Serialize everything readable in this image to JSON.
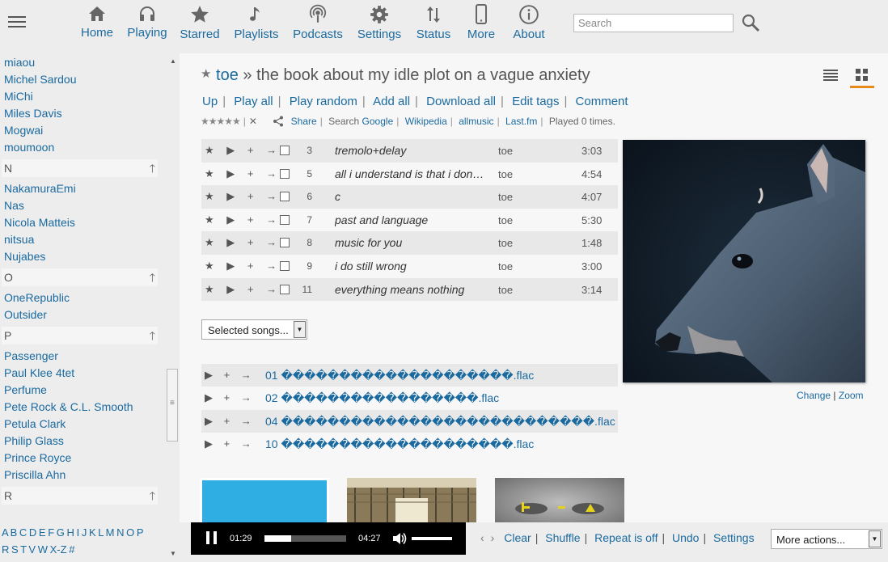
{
  "nav": {
    "home": "Home",
    "playing": "Playing",
    "starred": "Starred",
    "playlists": "Playlists",
    "podcasts": "Podcasts",
    "settings": "Settings",
    "status": "Status",
    "more": "More",
    "about": "About"
  },
  "search": {
    "placeholder": "Search"
  },
  "sidebar": {
    "group_m_tail": [
      "miaou",
      "Michel Sardou",
      "MiChi",
      "Miles Davis",
      "Mogwai",
      "moumoon"
    ],
    "group_n": {
      "letter": "N",
      "artists": [
        "NakamuraEmi",
        "Nas",
        "Nicola Matteis",
        "nitsua",
        "Nujabes"
      ]
    },
    "group_o": {
      "letter": "O",
      "artists": [
        "OneRepublic",
        "Outsider"
      ]
    },
    "group_p": {
      "letter": "P",
      "artists": [
        "Passenger",
        "Paul Klee 4tet",
        "Perfume",
        "Pete Rock & C.L. Smooth",
        "Petula Clark",
        "Philip Glass",
        "Prince Royce",
        "Priscilla Ahn"
      ]
    },
    "next_letter": "R",
    "up_arrow": "🡑",
    "alphabet_line1": "A B C D E F G H I J K L M N O P",
    "alphabet_line2": "R S T V W X-Z #"
  },
  "album": {
    "star": "★",
    "artist": "toe",
    "separator": "»",
    "title": "the book about my idle plot on a vague anxiety"
  },
  "actions": {
    "up": "Up",
    "play_all": "Play all",
    "play_random": "Play random",
    "add_all": "Add all",
    "download_all": "Download all",
    "edit_tags": "Edit tags",
    "comment": "Comment"
  },
  "meta": {
    "rating": "★★★★★",
    "clear": "✕",
    "share": "Share",
    "search_prefix": "Search",
    "google": "Google",
    "wikipedia": "Wikipedia",
    "allmusic": "allmusic",
    "lastfm": "Last.fm",
    "played": "Played 0 times."
  },
  "tracks": [
    {
      "num": "3",
      "title": "tremolo+delay",
      "artist": "toe",
      "length": "3:03"
    },
    {
      "num": "5",
      "title": "all i understand is that i don't understand",
      "artist": "toe",
      "length": "4:54"
    },
    {
      "num": "6",
      "title": "c",
      "artist": "toe",
      "length": "4:07"
    },
    {
      "num": "7",
      "title": "past and language",
      "artist": "toe",
      "length": "5:30"
    },
    {
      "num": "8",
      "title": "music for you",
      "artist": "toe",
      "length": "1:48"
    },
    {
      "num": "9",
      "title": "i do still wrong",
      "artist": "toe",
      "length": "3:00"
    },
    {
      "num": "11",
      "title": "everything means nothing",
      "artist": "toe",
      "length": "3:14"
    }
  ],
  "track_controls": "★ ▶ + →",
  "selected_songs": "Selected songs...",
  "files": [
    {
      "name": "01 ��������������������.flac"
    },
    {
      "name": "02 �����������������.flac"
    },
    {
      "name": "04 ���������������������������.flac"
    },
    {
      "name": "10 ��������������������.flac"
    }
  ],
  "file_controls": "▶ + →",
  "cover": {
    "change": "Change",
    "zoom": "Zoom",
    "sep": "|"
  },
  "player": {
    "current_time": "01:29",
    "total_time": "04:27",
    "progress": 0.33,
    "volume": 1.0
  },
  "bottom": {
    "prev": "‹",
    "next": "›",
    "clear": "Clear",
    "shuffle": "Shuffle",
    "repeat": "Repeat is off",
    "undo": "Undo",
    "settings": "Settings",
    "more_actions": "More actions..."
  },
  "colors": {
    "link": "#1a6aa0",
    "accent": "#e88a1a",
    "thumb_blue": "#2eaee3"
  }
}
